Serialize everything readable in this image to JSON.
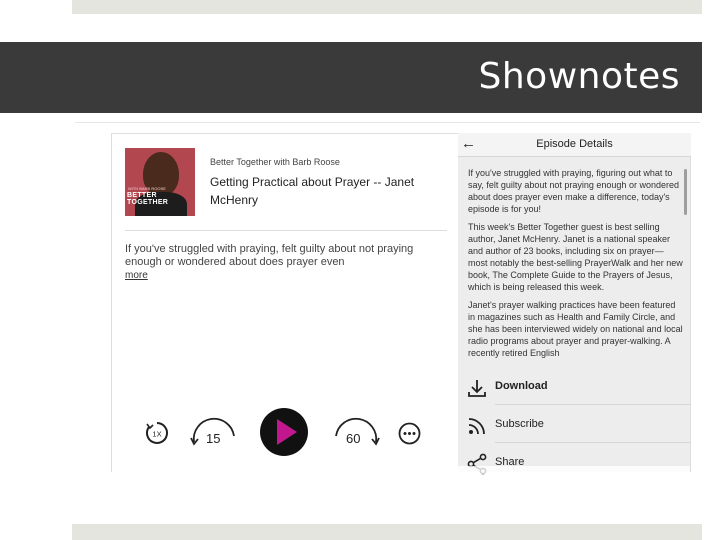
{
  "slide": {
    "title": "Shownotes"
  },
  "player": {
    "podcast_name": "Better Together with Barb Roose",
    "episode_title": "Getting Practical about Prayer -- Janet McHenry",
    "description": "If you've struggled with praying, felt guilty about not praying enough or wondered about does prayer even",
    "more_label": "more",
    "cover_art": {
      "small_text": "WITH BARB ROOSE",
      "brand_text": "BETTER TOGETHER",
      "colors": {
        "background": "#b3474f"
      }
    },
    "controls": {
      "speed_label": "1X",
      "rewind_seconds": "15",
      "forward_seconds": "60",
      "play_icon": "play-icon",
      "accent": "#c2188f"
    }
  },
  "details": {
    "header_title": "Episode Details",
    "back_icon": "back-arrow-icon",
    "paragraphs": [
      "If you've struggled with praying, figuring out what to say, felt guilty about not praying enough or wondered about does prayer even make a difference, today's episode is for you!",
      "This week's Better Together guest is best selling author, Janet McHenry. Janet is a national speaker and author of 23 books, including six on prayer—most notably the best-selling PrayerWalk and her new book, The Complete Guide to the Prayers of Jesus, which is being released this week.",
      "Janet's prayer walking practices have been featured in magazines such as Health and Family Circle, and she has been interviewed widely on national and local radio programs about prayer and prayer-walking. A recently retired English"
    ],
    "actions": [
      {
        "label": "Download",
        "icon": "download-icon"
      },
      {
        "label": "Subscribe",
        "icon": "rss-icon"
      },
      {
        "label": "Share",
        "icon": "share-icon"
      }
    ]
  }
}
